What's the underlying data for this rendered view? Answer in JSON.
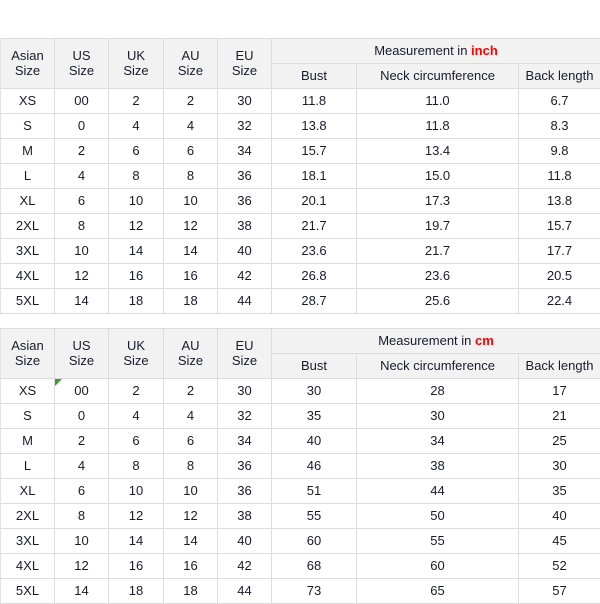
{
  "page": {
    "background": "#ffffff",
    "accent_red": "#ff0000",
    "text_color": "#1a1a2e",
    "header_bg": "#f2f2f2",
    "border_color": "#dcdcdc",
    "note_marker_color": "#3f9c35"
  },
  "tables": [
    {
      "id": "inch-table",
      "size_headers": [
        {
          "line1": "Asian",
          "line2": "Size"
        },
        {
          "line1": "US",
          "line2": "Size"
        },
        {
          "line1": "UK",
          "line2": "Size"
        },
        {
          "line1": "AU",
          "line2": "Size"
        },
        {
          "line1": "EU",
          "line2": "Size"
        }
      ],
      "measurement_title_prefix": "Measurement in ",
      "measurement_unit": "inch",
      "measurement_headers": [
        "Bust",
        "Neck circumference",
        "Back length"
      ],
      "rows": [
        {
          "asian": "XS",
          "us": "00",
          "uk": "2",
          "au": "2",
          "eu": "30",
          "bust": "11.8",
          "neck": "11.0",
          "back": "6.7"
        },
        {
          "asian": "S",
          "us": "0",
          "uk": "4",
          "au": "4",
          "eu": "32",
          "bust": "13.8",
          "neck": "11.8",
          "back": "8.3"
        },
        {
          "asian": "M",
          "us": "2",
          "uk": "6",
          "au": "6",
          "eu": "34",
          "bust": "15.7",
          "neck": "13.4",
          "back": "9.8"
        },
        {
          "asian": "L",
          "us": "4",
          "uk": "8",
          "au": "8",
          "eu": "36",
          "bust": "18.1",
          "neck": "15.0",
          "back": "11.8"
        },
        {
          "asian": "XL",
          "us": "6",
          "uk": "10",
          "au": "10",
          "eu": "36",
          "bust": "20.1",
          "neck": "17.3",
          "back": "13.8"
        },
        {
          "asian": "2XL",
          "us": "8",
          "uk": "12",
          "au": "12",
          "eu": "38",
          "bust": "21.7",
          "neck": "19.7",
          "back": "15.7"
        },
        {
          "asian": "3XL",
          "us": "10",
          "uk": "14",
          "au": "14",
          "eu": "40",
          "bust": "23.6",
          "neck": "21.7",
          "back": "17.7"
        },
        {
          "asian": "4XL",
          "us": "12",
          "uk": "16",
          "au": "16",
          "eu": "42",
          "bust": "26.8",
          "neck": "23.6",
          "back": "20.5"
        },
        {
          "asian": "5XL",
          "us": "14",
          "uk": "18",
          "au": "18",
          "eu": "44",
          "bust": "28.7",
          "neck": "25.6",
          "back": "22.4"
        }
      ],
      "has_note_marker": false
    },
    {
      "id": "cm-table",
      "size_headers": [
        {
          "line1": "Asian",
          "line2": "Size"
        },
        {
          "line1": "US",
          "line2": "Size"
        },
        {
          "line1": "UK",
          "line2": "Size"
        },
        {
          "line1": "AU",
          "line2": "Size"
        },
        {
          "line1": "EU",
          "line2": "Size"
        }
      ],
      "measurement_title_prefix": "Measurement in ",
      "measurement_unit": "cm",
      "measurement_headers": [
        "Bust",
        "Neck circumference",
        "Back length"
      ],
      "rows": [
        {
          "asian": "XS",
          "us": "00",
          "uk": "2",
          "au": "2",
          "eu": "30",
          "bust": "30",
          "neck": "28",
          "back": "17"
        },
        {
          "asian": "S",
          "us": "0",
          "uk": "4",
          "au": "4",
          "eu": "32",
          "bust": "35",
          "neck": "30",
          "back": "21"
        },
        {
          "asian": "M",
          "us": "2",
          "uk": "6",
          "au": "6",
          "eu": "34",
          "bust": "40",
          "neck": "34",
          "back": "25"
        },
        {
          "asian": "L",
          "us": "4",
          "uk": "8",
          "au": "8",
          "eu": "36",
          "bust": "46",
          "neck": "38",
          "back": "30"
        },
        {
          "asian": "XL",
          "us": "6",
          "uk": "10",
          "au": "10",
          "eu": "36",
          "bust": "51",
          "neck": "44",
          "back": "35"
        },
        {
          "asian": "2XL",
          "us": "8",
          "uk": "12",
          "au": "12",
          "eu": "38",
          "bust": "55",
          "neck": "50",
          "back": "40"
        },
        {
          "asian": "3XL",
          "us": "10",
          "uk": "14",
          "au": "14",
          "eu": "40",
          "bust": "60",
          "neck": "55",
          "back": "45"
        },
        {
          "asian": "4XL",
          "us": "12",
          "uk": "16",
          "au": "16",
          "eu": "42",
          "bust": "68",
          "neck": "60",
          "back": "52"
        },
        {
          "asian": "5XL",
          "us": "14",
          "uk": "18",
          "au": "18",
          "eu": "44",
          "bust": "73",
          "neck": "65",
          "back": "57"
        }
      ],
      "has_note_marker": true,
      "note_marker_row": 0,
      "note_marker_column": "us"
    }
  ]
}
